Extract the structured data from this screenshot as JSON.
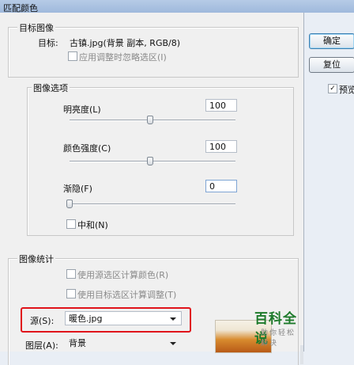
{
  "window": {
    "title": "匹配颜色"
  },
  "target_image": {
    "group_title": "目标图像",
    "target_label": "目标:",
    "target_value": "古镇.jpg(背景 副本, RGB/8)",
    "ignore_selection_label": "应用调整时忽略选区(I)",
    "ignore_selection_checked": false
  },
  "image_options": {
    "group_title": "图像选项",
    "luminance": {
      "label": "明亮度(L)",
      "value": "100",
      "slider": 0.5
    },
    "color_intensity": {
      "label": "颜色强度(C)",
      "value": "100",
      "slider": 0.5
    },
    "fade": {
      "label": "渐隐(F)",
      "value": "0",
      "slider": 0.0
    },
    "neutralize": {
      "label": "中和(N)",
      "checked": false
    }
  },
  "image_statistics": {
    "group_title": "图像统计",
    "use_source_selection_label": "使用源选区计算颜色(R)",
    "use_target_selection_label": "使用目标选区计算调整(T)",
    "source_label": "源(S):",
    "source_value": "暖色.jpg",
    "layer_label": "图层(A):",
    "layer_value": "背景"
  },
  "buttons": {
    "ok": "确定",
    "reset": "复位"
  },
  "preview": {
    "label": "预览",
    "checked": true
  },
  "watermark": {
    "brand": "百科全说",
    "slogan": "助你轻松解决"
  },
  "colors": {
    "highlight": "#e0131a",
    "brand_green": "#1d7a2b"
  }
}
